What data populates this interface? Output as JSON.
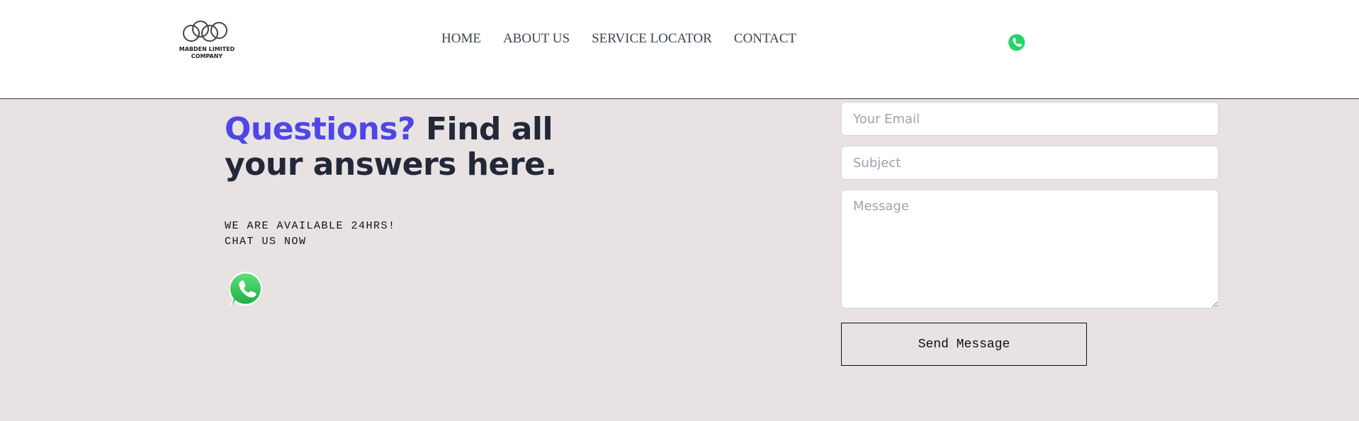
{
  "header": {
    "logo_text_line1": "MABDEN LIMITED",
    "logo_text_line2": "COMPANY",
    "nav": [
      {
        "label": "HOME"
      },
      {
        "label": "ABOUT US"
      },
      {
        "label": "SERVICE LOCATOR"
      },
      {
        "label": "CONTACT"
      }
    ],
    "whatsapp_icon": "whatsapp-icon"
  },
  "hero": {
    "title_accent": "Questions?",
    "title_rest": " Find all your answers here.",
    "availability_line1": "WE ARE AVAILABLE 24HRS!",
    "availability_line2": "CHAT US NOW",
    "whatsapp_icon": "whatsapp-icon"
  },
  "form": {
    "email_placeholder": "Your Email",
    "subject_placeholder": "Subject",
    "message_placeholder": "Message",
    "send_label": "Send Message"
  },
  "colors": {
    "accent": "#4f46e5",
    "background": "#e8e2e3",
    "whatsapp_green": "#25d366"
  }
}
